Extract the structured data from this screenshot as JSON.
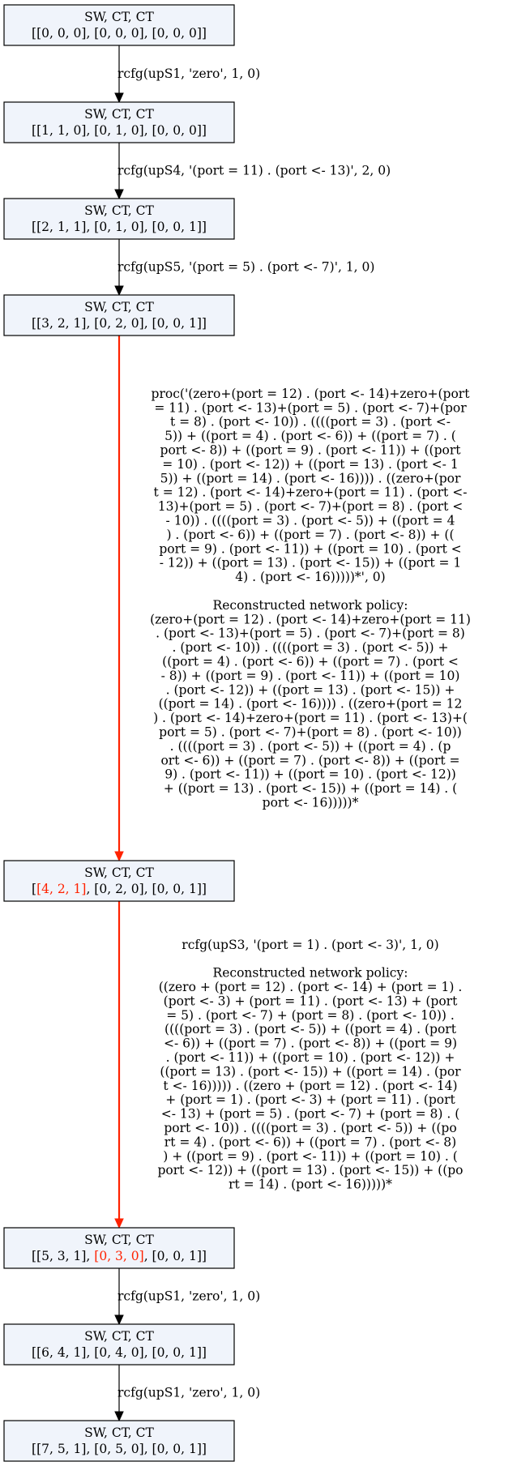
{
  "colors": {
    "highlight": "#ff2200",
    "node_fill": "#f0f4fb",
    "edge": "#000000"
  },
  "nodes": [
    {
      "title": "SW, CT, CT",
      "state": [
        {
          "t": "[[0, 0, 0], [0, 0, 0], [0, 0, 0]]",
          "hl": false
        }
      ]
    },
    {
      "title": "SW, CT, CT",
      "state": [
        {
          "t": "[[1, 1, 0], [0, 1, 0], [0, 0, 0]]",
          "hl": false
        }
      ]
    },
    {
      "title": "SW, CT, CT",
      "state": [
        {
          "t": "[[2, 1, 1], [0, 1, 0], [0, 0, 1]]",
          "hl": false
        }
      ]
    },
    {
      "title": "SW, CT, CT",
      "state": [
        {
          "t": "[[3, 2, 1], [0, 2, 0], [0, 0, 1]]",
          "hl": false
        }
      ]
    },
    {
      "title": "SW, CT, CT",
      "state": [
        {
          "t": "[",
          "hl": false
        },
        {
          "t": "[4, 2, 1]",
          "hl": true
        },
        {
          "t": ", [0, 2, 0], [0, 0, 1]]",
          "hl": false
        }
      ]
    },
    {
      "title": "SW, CT, CT",
      "state": [
        {
          "t": "[[5, 3, 1], ",
          "hl": false
        },
        {
          "t": "[0, 3, 0]",
          "hl": true
        },
        {
          "t": ", [0, 0, 1]]",
          "hl": false
        }
      ]
    },
    {
      "title": "SW, CT, CT",
      "state": [
        {
          "t": "[[6, 4, 1], [0, 4, 0], [0, 0, 1]]",
          "hl": false
        }
      ]
    },
    {
      "title": "SW, CT, CT",
      "state": [
        {
          "t": "[[7, 5, 1], [0, 5, 0], [0, 0, 1]]",
          "hl": false
        }
      ]
    }
  ],
  "edges": [
    {
      "from": 0,
      "to": 1,
      "highlight": false,
      "label_lines": [
        "rcfg(upS1, 'zero', 1, 0)"
      ]
    },
    {
      "from": 1,
      "to": 2,
      "highlight": false,
      "label_lines": [
        "rcfg(upS4, '(port = 11) . (port <- 13)', 2, 0)"
      ]
    },
    {
      "from": 2,
      "to": 3,
      "highlight": false,
      "label_lines": [
        "rcfg(upS5, '(port = 5) . (port <- 7)', 1, 0)"
      ]
    },
    {
      "from": 3,
      "to": 4,
      "highlight": true,
      "label_lines": [
        "proc('(zero+(port = 12) . (port <- 14)+zero+(port",
        "= 11) . (port <- 13)+(port = 5) . (port <- 7)+(por",
        "t = 8) . (port <- 10)) . ((((port = 3) . (port <-",
        "5)) + ((port = 4) . (port <- 6)) + ((port = 7) . (",
        "port <- 8)) + ((port = 9) . (port <- 11)) + ((port",
        "= 10) . (port <- 12)) + ((port = 13) . (port <- 1",
        "5)) + ((port = 14) . (port <- 16)))) . ((zero+(por",
        "t = 12) . (port <- 14)+zero+(port = 11) . (port <-",
        "13)+(port = 5) . (port <- 7)+(port = 8) . (port <",
        "- 10)) . ((((port = 3) . (port <- 5)) + ((port = 4",
        ") . (port <- 6)) + ((port = 7) . (port <- 8)) + ((",
        "port = 9) . (port <- 11)) + ((port = 10) . (port <",
        "- 12)) + ((port = 13) . (port <- 15)) + ((port = 1",
        "4) . (port <- 16)))))*', 0)",
        "",
        "Reconstructed network policy:",
        "(zero+(port = 12) . (port <- 14)+zero+(port = 11)",
        ". (port <- 13)+(port = 5) . (port <- 7)+(port = 8)",
        ". (port <- 10)) . ((((port = 3) . (port <- 5)) +",
        "((port = 4) . (port <- 6)) + ((port = 7) . (port <",
        "- 8)) + ((port = 9) . (port <- 11)) + ((port = 10)",
        ". (port <- 12)) + ((port = 13) . (port <- 15)) +",
        "((port = 14) . (port <- 16)))) . ((zero+(port = 12",
        ") . (port <- 14)+zero+(port = 11) . (port <- 13)+(",
        "port = 5) . (port <- 7)+(port = 8) . (port <- 10))",
        ". ((((port = 3) . (port <- 5)) + ((port = 4) . (p",
        "ort <- 6)) + ((port = 7) . (port <- 8)) + ((port =",
        "9) . (port <- 11)) + ((port = 10) . (port <- 12))",
        "+ ((port = 13) . (port <- 15)) + ((port = 14) . (",
        "port <- 16)))))*"
      ]
    },
    {
      "from": 4,
      "to": 5,
      "highlight": true,
      "label_lines": [
        "rcfg(upS3, '(port = 1) . (port <- 3)', 1, 0)",
        "",
        "Reconstructed network policy:",
        "((zero + (port = 12) . (port <- 14) + (port = 1) .",
        "(port <- 3) + (port = 11) . (port <- 13) + (port",
        "= 5) . (port <- 7) + (port = 8) . (port <- 10)) .",
        "((((port = 3) . (port <- 5)) + ((port = 4) . (port",
        "<- 6)) + ((port = 7) . (port <- 8)) + ((port = 9)",
        ". (port <- 11)) + ((port = 10) . (port <- 12)) +",
        "((port = 13) . (port <- 15)) + ((port = 14) . (por",
        "t <- 16))))) . ((zero + (port = 12) . (port <- 14)",
        "+ (port = 1) . (port <- 3) + (port = 11) . (port",
        "<- 13) + (port = 5) . (port <- 7) + (port = 8) . (",
        "port <- 10)) . ((((port = 3) . (port <- 5)) + ((po",
        "rt = 4) . (port <- 6)) + ((port = 7) . (port <- 8)",
        ") + ((port = 9) . (port <- 11)) + ((port = 10) . (",
        "port <- 12)) + ((port = 13) . (port <- 15)) + ((po",
        "rt = 14) . (port <- 16)))))*"
      ]
    },
    {
      "from": 5,
      "to": 6,
      "highlight": false,
      "label_lines": [
        "rcfg(upS1, 'zero', 1, 0)"
      ]
    },
    {
      "from": 6,
      "to": 7,
      "highlight": false,
      "label_lines": [
        "rcfg(upS1, 'zero', 1, 0)"
      ]
    }
  ]
}
